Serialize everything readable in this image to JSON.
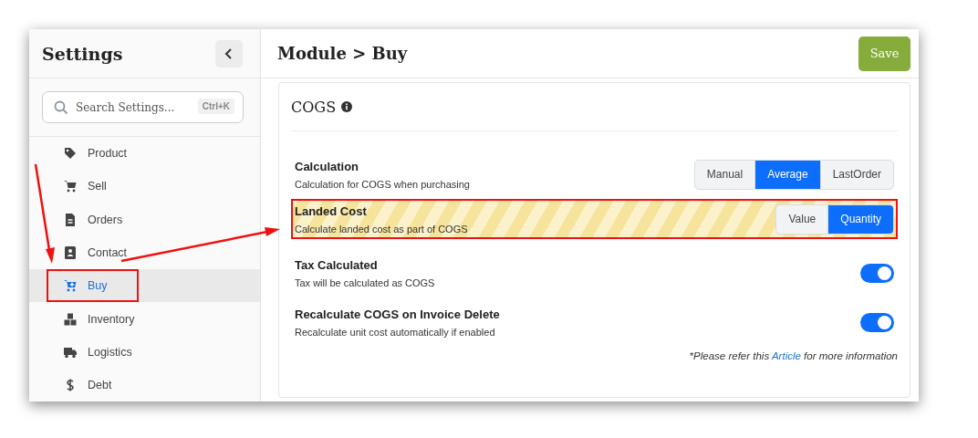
{
  "sidebar": {
    "title": "Settings",
    "search": {
      "placeholder": "Search Settings...",
      "shortcut": "Ctrl+K"
    },
    "items": [
      {
        "label": "Product",
        "selected": false
      },
      {
        "label": "Sell",
        "selected": false
      },
      {
        "label": "Orders",
        "selected": false
      },
      {
        "label": "Contact",
        "selected": false
      },
      {
        "label": "Buy",
        "selected": true
      },
      {
        "label": "Inventory",
        "selected": false
      },
      {
        "label": "Logistics",
        "selected": false
      },
      {
        "label": "Debt",
        "selected": false
      }
    ]
  },
  "main": {
    "title": "Module > Buy",
    "save_button": "Save",
    "section": {
      "title": "COGS",
      "rows": [
        {
          "kind": "segmented",
          "title": "Calculation",
          "description": "Calculation for COGS when purchasing",
          "highlighted": false,
          "options": [
            {
              "label": "Manual",
              "selected": false
            },
            {
              "label": "Average",
              "selected": true
            },
            {
              "label": "LastOrder",
              "selected": false
            }
          ]
        },
        {
          "kind": "segmented",
          "title": "Landed Cost",
          "description": "Calculate landed cost as part of COGS",
          "highlighted": true,
          "options": [
            {
              "label": "Value",
              "selected": false
            },
            {
              "label": "Quantity",
              "selected": true
            }
          ]
        },
        {
          "kind": "toggle",
          "title": "Tax Calculated",
          "description": "Tax will be calculated as COGS",
          "highlighted": false,
          "on": true
        },
        {
          "kind": "toggle",
          "title": "Recalculate COGS on Invoice Delete",
          "description": "Recalculate unit cost automatically if enabled",
          "highlighted": false,
          "on": true
        }
      ],
      "footnote": {
        "before": "*Please refer this ",
        "link": "Article",
        "after": " for more information"
      }
    }
  }
}
